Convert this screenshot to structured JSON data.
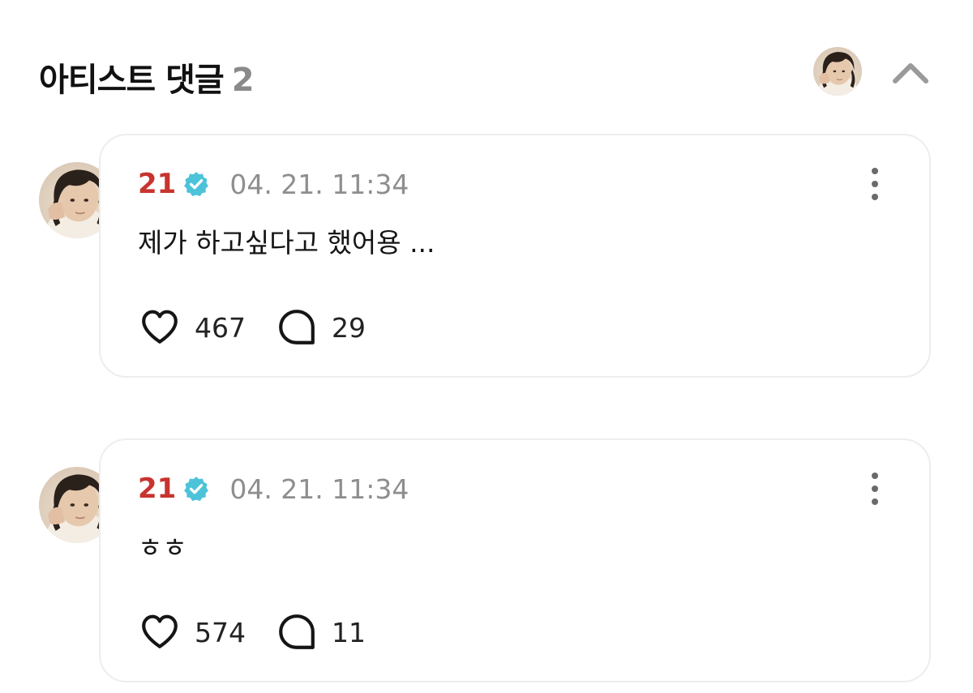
{
  "header": {
    "title": "아티스트 댓글",
    "count": "2",
    "avatar_icon": "profile-photo",
    "collapse_icon": "chevron-up-icon"
  },
  "colors": {
    "author": "#c8342e",
    "verified": "#4cc3d9",
    "muted": "#8e8e8e",
    "border": "#ededed"
  },
  "comments": [
    {
      "author": "21",
      "verified_icon": "verified-badge-icon",
      "timestamp": "04. 21. 11:34",
      "text": "제가 하고싶다고 했어용 ...",
      "likes": "467",
      "replies": "29"
    },
    {
      "author": "21",
      "verified_icon": "verified-badge-icon",
      "timestamp": "04. 21. 11:34",
      "text": "ㅎㅎ",
      "likes": "574",
      "replies": "11"
    }
  ]
}
